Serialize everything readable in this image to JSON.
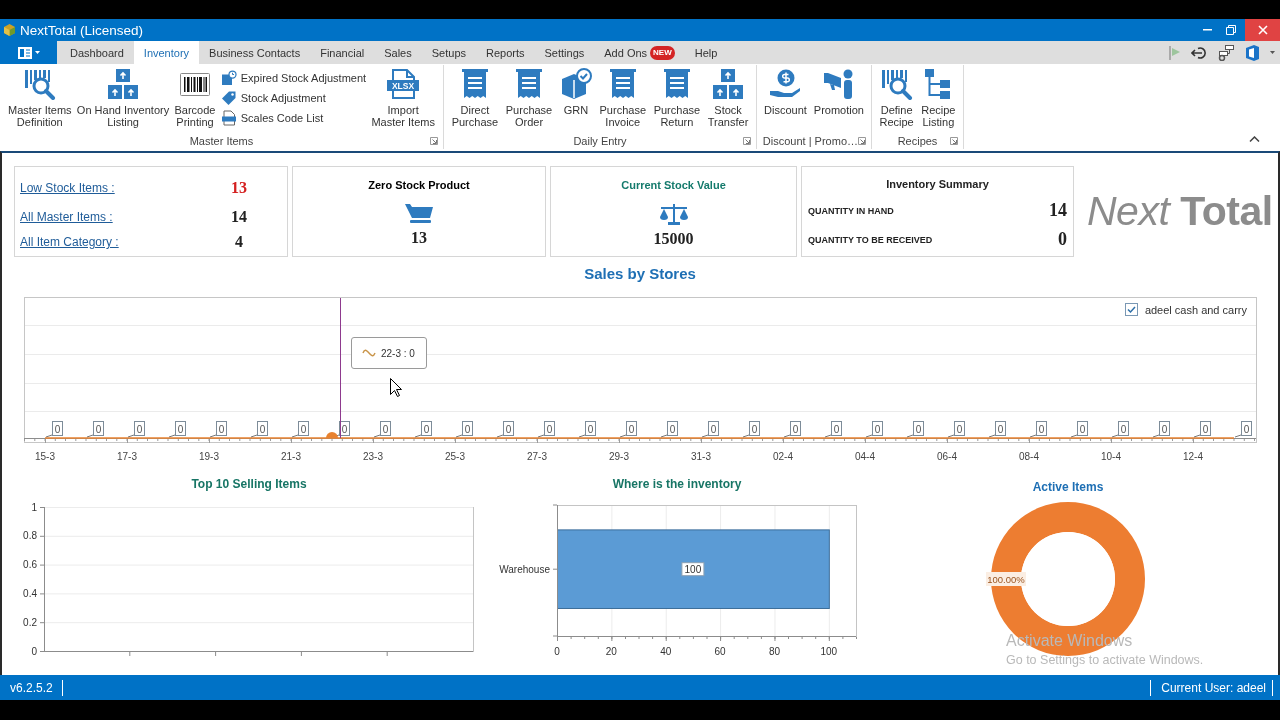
{
  "window": {
    "title": "NextTotal (Licensed)"
  },
  "tabs": [
    {
      "label": "Dashboard",
      "selected": false
    },
    {
      "label": "Inventory",
      "selected": true
    },
    {
      "label": "Business Contacts",
      "selected": false
    },
    {
      "label": "Financial",
      "selected": false
    },
    {
      "label": "Sales",
      "selected": false
    },
    {
      "label": "Setups",
      "selected": false
    },
    {
      "label": "Reports",
      "selected": false
    },
    {
      "label": "Settings",
      "selected": false
    },
    {
      "label": "Add Ons",
      "selected": false,
      "badge": "NEW"
    },
    {
      "label": "Help",
      "selected": false
    }
  ],
  "ribbon": {
    "groups": [
      {
        "label": "Master Items",
        "items": [
          {
            "kind": "large",
            "label": "Master Items\nDefinition"
          },
          {
            "kind": "large",
            "label": "On Hand Inventory\nListing"
          },
          {
            "kind": "large",
            "label": "Barcode\nPrinting"
          },
          {
            "kind": "small",
            "label": "Expired Stock Adjustment"
          },
          {
            "kind": "small",
            "label": "Stock Adjustment"
          },
          {
            "kind": "small",
            "label": "Scales Code List"
          },
          {
            "kind": "large",
            "label": "Import\nMaster Items",
            "icon_text": "XLSX"
          }
        ]
      },
      {
        "label": "Daily Entry",
        "items": [
          {
            "kind": "large",
            "label": "Direct\nPurchase"
          },
          {
            "kind": "large",
            "label": "Purchase\nOrder"
          },
          {
            "kind": "large",
            "label": "GRN"
          },
          {
            "kind": "large",
            "label": "Purchase\nInvoice"
          },
          {
            "kind": "large",
            "label": "Purchase\nReturn"
          },
          {
            "kind": "large",
            "label": "Stock\nTransfer"
          }
        ]
      },
      {
        "label": "Discount | Promo…",
        "items": [
          {
            "kind": "large",
            "label": "Discount"
          },
          {
            "kind": "large",
            "label": "Promotion"
          }
        ]
      },
      {
        "label": "Recipes",
        "items": [
          {
            "kind": "large",
            "label": "Define\nRecipe"
          },
          {
            "kind": "large",
            "label": "Recipe\nListing"
          }
        ]
      }
    ]
  },
  "summary": {
    "links": [
      {
        "label": "Low Stock Items :",
        "value": "13",
        "alert": true
      },
      {
        "label": "All Master Items :",
        "value": "14",
        "alert": false
      },
      {
        "label": "All Item Category :",
        "value": "4",
        "alert": false
      }
    ]
  },
  "stat_cards": [
    {
      "title": "Zero Stock Product",
      "value": "13",
      "color": "#000000"
    },
    {
      "title": "Current Stock Value",
      "value": "15000",
      "color": "#147a6c"
    }
  ],
  "inventory_summary": {
    "title": "Inventory Summary",
    "rows": [
      {
        "label": "QUANTITY IN HAND",
        "value": "14"
      },
      {
        "label": "QUANTITY TO BE RECEIVED",
        "value": "0"
      }
    ]
  },
  "logo": "*Next* **Total**",
  "sales_chart": {
    "title": "Sales by Stores",
    "legend": {
      "label": "adeel cash and carry",
      "checked": true
    },
    "tooltip": "22-3 : 0",
    "axis_labels": [
      "15-3",
      "17-3",
      "19-3",
      "21-3",
      "23-3",
      "25-3",
      "27-3",
      "29-3",
      "31-3",
      "02-4",
      "04-4",
      "06-4",
      "08-4",
      "10-4",
      "12-4"
    ],
    "points": [
      {
        "label": "0",
        "hovered": false
      },
      {
        "label": "0",
        "hovered": false
      },
      {
        "label": "0",
        "hovered": false
      },
      {
        "label": "0",
        "hovered": false
      },
      {
        "label": "0",
        "hovered": false
      },
      {
        "label": "0",
        "hovered": false
      },
      {
        "label": "0",
        "hovered": false
      },
      {
        "label": "0",
        "hovered": true
      },
      {
        "label": "0",
        "hovered": false
      },
      {
        "label": "0",
        "hovered": false
      },
      {
        "label": "0",
        "hovered": false
      },
      {
        "label": "0",
        "hovered": false
      },
      {
        "label": "0",
        "hovered": false
      },
      {
        "label": "0",
        "hovered": false
      },
      {
        "label": "0",
        "hovered": false
      },
      {
        "label": "0",
        "hovered": false
      },
      {
        "label": "0",
        "hovered": false
      },
      {
        "label": "0",
        "hovered": false
      },
      {
        "label": "0",
        "hovered": false
      },
      {
        "label": "0",
        "hovered": false
      },
      {
        "label": "0",
        "hovered": false
      },
      {
        "label": "0",
        "hovered": false
      },
      {
        "label": "0",
        "hovered": false
      },
      {
        "label": "0",
        "hovered": false
      },
      {
        "label": "0",
        "hovered": false
      },
      {
        "label": "0",
        "hovered": false
      },
      {
        "label": "0",
        "hovered": false
      },
      {
        "label": "0",
        "hovered": false
      },
      {
        "label": "0",
        "hovered": false
      },
      {
        "label": "0",
        "hovered": false
      }
    ]
  },
  "top_selling": {
    "chart_data": {
      "type": "bar",
      "title": "Top 10 Selling Items",
      "grid": true,
      "categories": [
        null,
        null,
        null,
        null,
        null
      ],
      "values": [
        null,
        null,
        null,
        null,
        null
      ],
      "ylim": [
        0,
        1
      ],
      "yticks": [
        0,
        0.2,
        0.4,
        0.6,
        0.8,
        1
      ]
    }
  },
  "inventory_location": {
    "chart_data": {
      "type": "bar",
      "orientation": "horizontal",
      "title": "Where is the inventory",
      "grid": true,
      "categories": [
        "Warehouse"
      ],
      "series": [
        {
          "color": "#5b9bd5",
          "values": [
            100
          ]
        }
      ],
      "xlim": [
        0,
        110
      ],
      "xticks": [
        0,
        20,
        40,
        60,
        80,
        100
      ],
      "data_labels": true
    }
  },
  "active_items": {
    "chart_data": {
      "type": "donut",
      "title": "Active Items",
      "series": [
        {
          "color": "#ed7d31",
          "values": [
            100
          ]
        }
      ],
      "value_labels": [
        "100.00%"
      ]
    }
  },
  "activation_notice": {
    "title": "Activate Windows",
    "text": "Go to Settings to activate Windows."
  },
  "status_bar": {
    "version": "v6.2.5.2",
    "user": "Current User: adeel"
  }
}
